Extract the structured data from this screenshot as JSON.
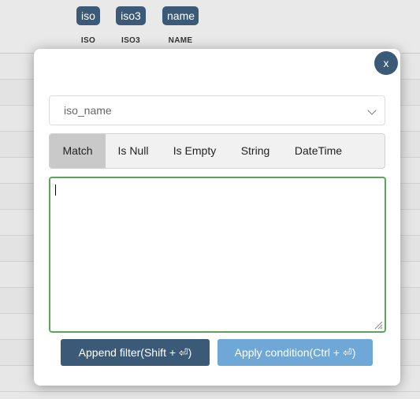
{
  "table": {
    "columns": [
      {
        "chip": "iso",
        "label": "ISO"
      },
      {
        "chip": "iso3",
        "label": "ISO3"
      },
      {
        "chip": "name",
        "label": "NAME"
      }
    ]
  },
  "modal": {
    "close_label": "x",
    "field_select": {
      "value": "iso_name"
    },
    "tabs": [
      {
        "label": "Match",
        "active": true
      },
      {
        "label": "Is Null",
        "active": false
      },
      {
        "label": "Is Empty",
        "active": false
      },
      {
        "label": "String",
        "active": false
      },
      {
        "label": "DateTime",
        "active": false
      }
    ],
    "editor_value": "",
    "buttons": {
      "append": "Append filter(Shift + ⏎)",
      "apply": "Apply condition(Ctrl + ⏎)"
    }
  },
  "colors": {
    "accent": "#3b5a78",
    "apply_button": "#6fa8d6",
    "editor_focus_border": "#5aa55a",
    "active_tab": "#c9c9c9"
  }
}
